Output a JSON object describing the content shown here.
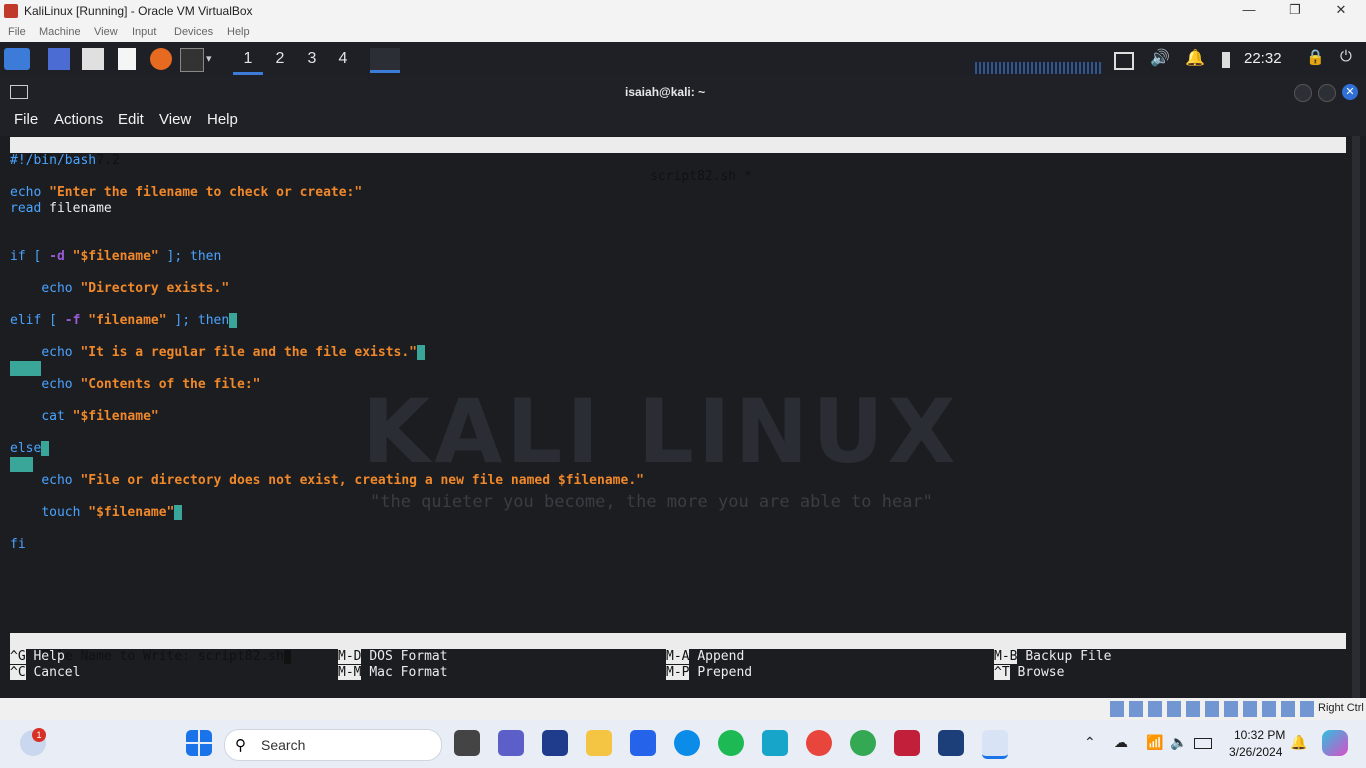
{
  "window": {
    "title": "KaliLinux [Running] - Oracle VM VirtualBox",
    "menu": [
      "File",
      "Machine",
      "View",
      "Input",
      "Devices",
      "Help"
    ]
  },
  "kali_panel": {
    "workspaces": [
      "1",
      "2",
      "3",
      "4"
    ],
    "active_workspace": "1",
    "clock": "22:32"
  },
  "terminal": {
    "title": "isaiah@kali: ~",
    "menu": [
      "File",
      "Actions",
      "Edit",
      "View",
      "Help"
    ]
  },
  "nano": {
    "version": "GNU nano 7.2",
    "filename": "script82.sh *",
    "lines": {
      "shebang": "#!/bin/bash",
      "l3_kw": "echo",
      "l3_str": "\"Enter the filename to check or create:\"",
      "l4_kw": "read",
      "l4_rest": "filename",
      "l7_a": "if [ ",
      "l7_flag": "-d",
      "l7_str": "\"$filename\"",
      "l7_b": " ]; then",
      "l9_kw": "echo",
      "l9_str": "\"Directory exists.\"",
      "l11_a": "elif [ ",
      "l11_flag": "-f",
      "l11_str": "\"filename\"",
      "l11_b": " ]; then",
      "l13_kw": "echo",
      "l13_str": "\"It is a regular file and the file exists.\"",
      "l15_kw": "echo",
      "l15_str": "\"Contents of the file:\"",
      "l17_kw": "cat",
      "l17_str": "\"$filename\"",
      "l19": "else",
      "l21_kw": "echo",
      "l21_str": "\"File or directory does not exist, creating a new file named $filename.\"",
      "l23_kw": "touch",
      "l23_str": "\"$filename\"",
      "l25": "fi"
    },
    "prompt": "File Name to Write: script82.sh",
    "shortcuts": [
      {
        "key": "^G",
        "label": "Help"
      },
      {
        "key": "M-D",
        "label": "DOS Format"
      },
      {
        "key": "M-A",
        "label": "Append"
      },
      {
        "key": "M-B",
        "label": "Backup File"
      },
      {
        "key": "^C",
        "label": "Cancel"
      },
      {
        "key": "M-M",
        "label": "Mac Format"
      },
      {
        "key": "M-P",
        "label": "Prepend"
      },
      {
        "key": "^T",
        "label": "Browse"
      }
    ]
  },
  "background": {
    "watermark": "KALI LINUX",
    "quote": "\"the quieter you become, the more you are able to hear\""
  },
  "vb_status": {
    "host_key": "Right Ctrl"
  },
  "taskbar": {
    "search_placeholder": "Search",
    "time": "10:32 PM",
    "date": "3/26/2024",
    "weather_badge": "1"
  }
}
